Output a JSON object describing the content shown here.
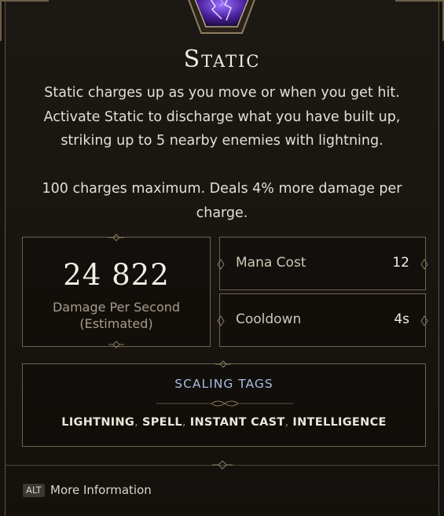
{
  "skill": {
    "name": "Static",
    "description": [
      "Static charges up as you move or when you get hit.",
      "Activate Static to discharge what you have built up,",
      "striking up to 5 nearby enemies with lightning."
    ],
    "extra": [
      "100 charges maximum. Deals 4% more damage per",
      "charge."
    ]
  },
  "damage": {
    "value": "24 822",
    "label": "Damage Per Second",
    "sublabel": "(Estimated)"
  },
  "stats": [
    {
      "name": "Mana Cost",
      "value": "12"
    },
    {
      "name": "Cooldown",
      "value": "4s"
    }
  ],
  "scaling": {
    "title": "SCALING TAGS",
    "tags": [
      "LIGHTNING",
      "SPELL",
      "INSTANT CAST",
      "INTELLIGENCE"
    ]
  },
  "footer": {
    "key": "ALT",
    "label": "More Information"
  },
  "colors": {
    "background": "#1a1712",
    "border": "#6e6450",
    "scaling_title": "#a9bde0",
    "icon_purple": "#5a2fb8"
  },
  "icons": {
    "skill": "lightning-storm-icon"
  }
}
